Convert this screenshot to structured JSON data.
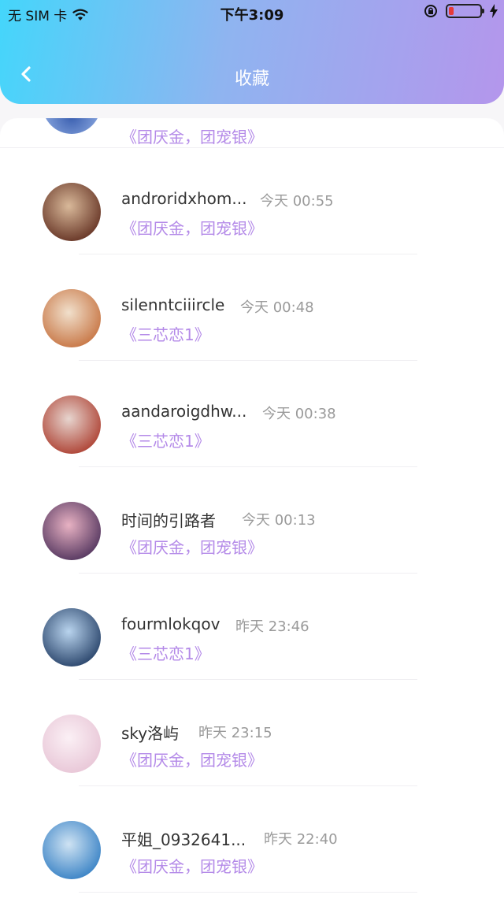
{
  "status": {
    "carrier": "无 SIM 卡",
    "time": "下午3:09",
    "battery_level": 0.15,
    "battery_color": "#e53a3a"
  },
  "nav": {
    "title": "收藏"
  },
  "partial_item": {
    "book": "《团厌金，团宠银》"
  },
  "items": [
    {
      "name": "androridxhom...",
      "time": "今天 00:55",
      "book": "《团厌金，团宠银》",
      "avatar_colors": [
        "#6b3a2a",
        "#d9b99a"
      ]
    },
    {
      "name": "silenntciiircle",
      "time": "今天 00:48",
      "book": "《三芯恋1》",
      "avatar_colors": [
        "#c97a4a",
        "#f1e0cc"
      ]
    },
    {
      "name": "aandaroigdhw...",
      "time": "今天 00:38",
      "book": "《三芯恋1》",
      "avatar_colors": [
        "#b0483a",
        "#e7d5cf"
      ]
    },
    {
      "name": "时间的引路者",
      "time": "今天 00:13",
      "book": "《团厌金，团宠银》",
      "avatar_colors": [
        "#5a3b63",
        "#e8b2c3"
      ]
    },
    {
      "name": "fourmlokqov",
      "time": "昨天 23:46",
      "book": "《三芯恋1》",
      "avatar_colors": [
        "#2f4a70",
        "#b9d4ee"
      ]
    },
    {
      "name": "sky洛屿",
      "time": "昨天 23:15",
      "book": "《团厌金，团宠银》",
      "avatar_colors": [
        "#e9c8d8",
        "#fbf0f5"
      ]
    },
    {
      "name": "平姐_0932641...",
      "time": "昨天 22:40",
      "book": "《团厌金，团宠银》",
      "avatar_colors": [
        "#3f86c7",
        "#cfe3f3"
      ]
    }
  ],
  "colors": {
    "accent": "#b48ae8",
    "gradient_start": "#44d6fb",
    "gradient_end": "#b496ec"
  },
  "icons": {
    "back": "chevron-left-icon",
    "wifi": "wifi-icon",
    "lock": "rotation-lock-icon",
    "charging": "bolt-icon"
  }
}
